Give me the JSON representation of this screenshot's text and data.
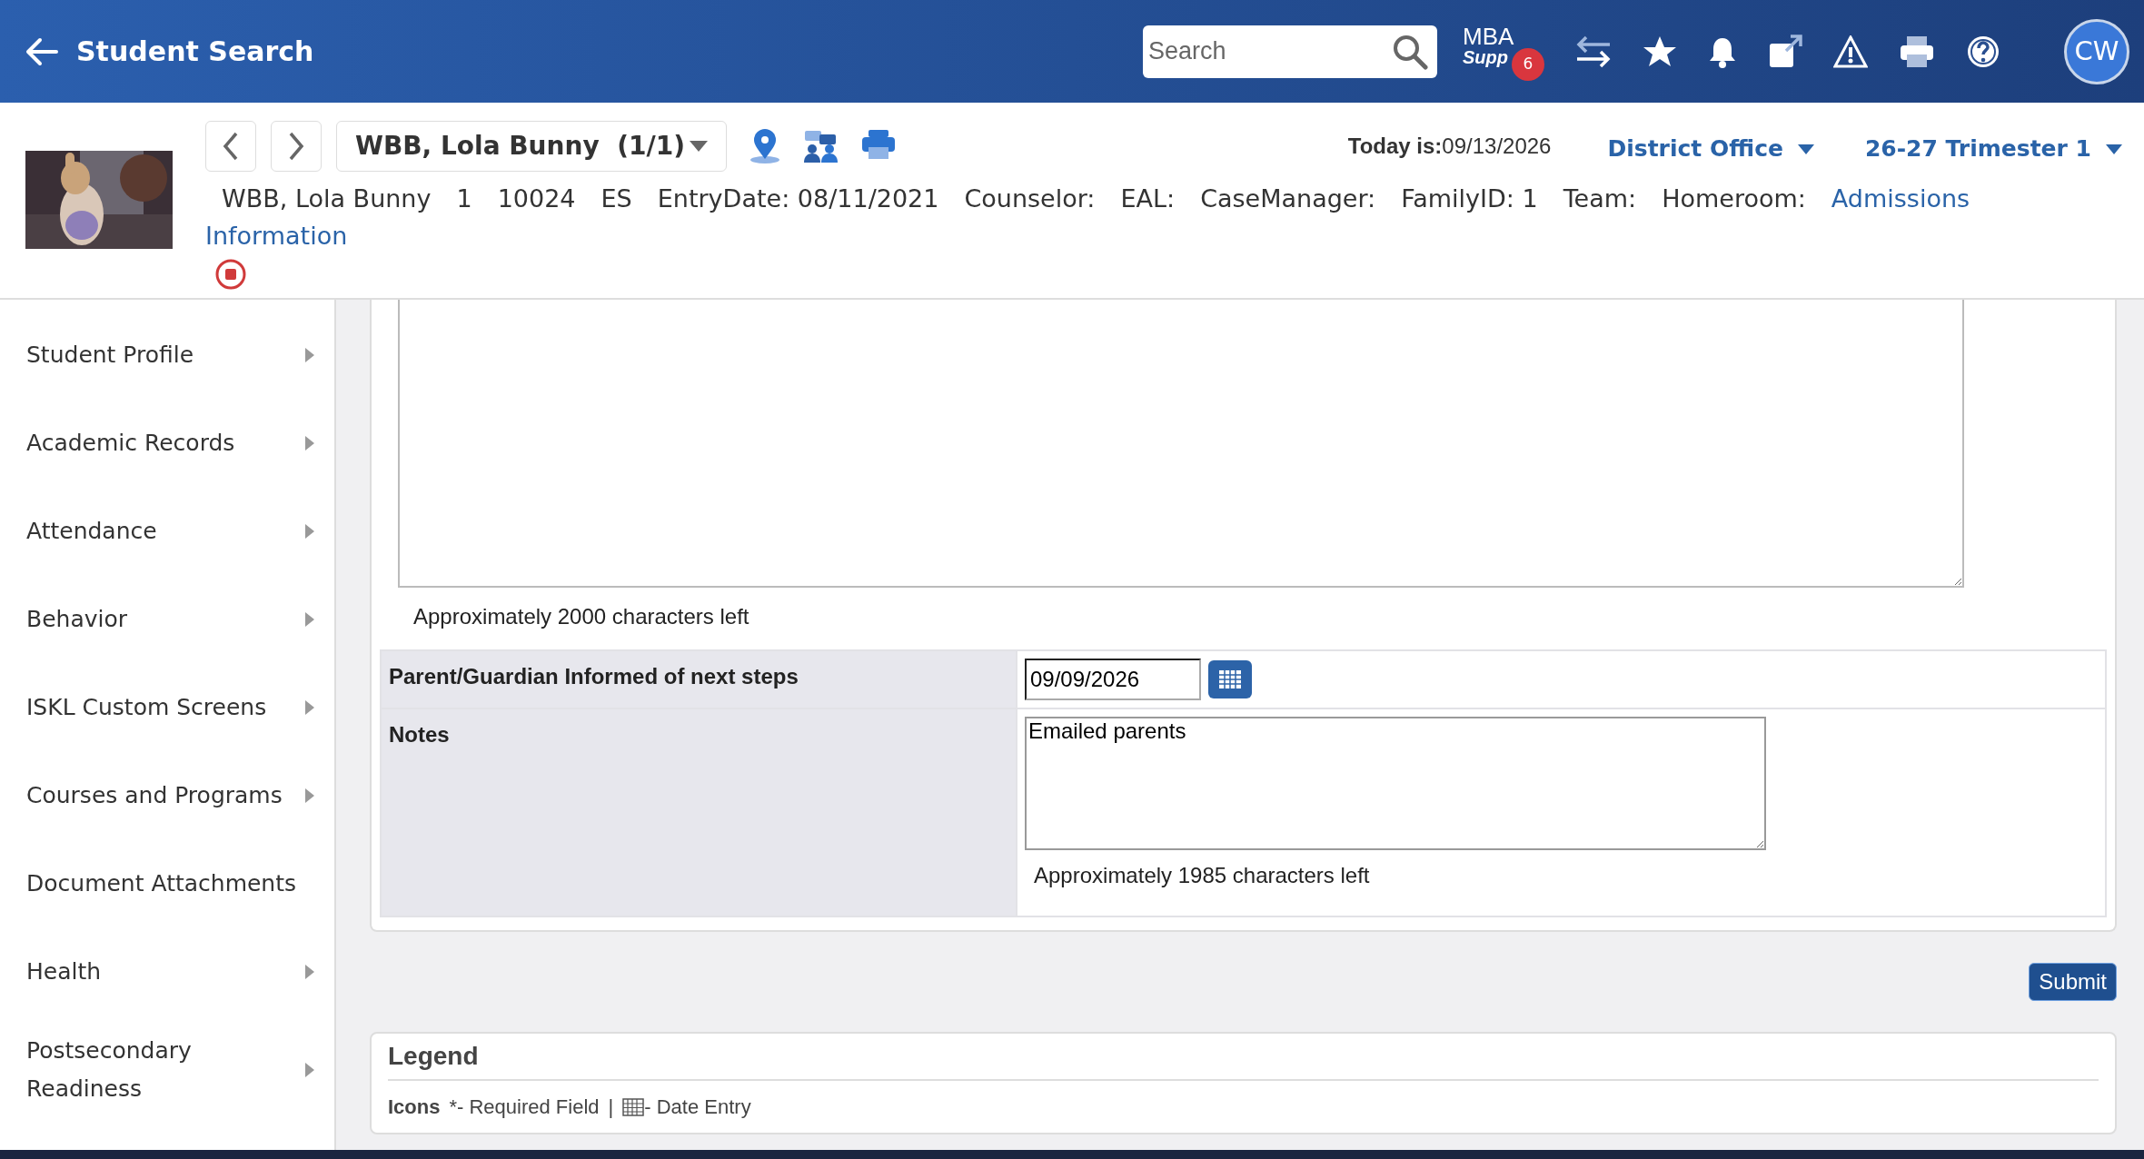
{
  "header": {
    "title": "Student Search",
    "search": {
      "placeholder": "Search"
    },
    "support_logo": {
      "line1": "MBA",
      "line2": "Supp",
      "badge": "6"
    },
    "avatar": "CW"
  },
  "student_bar": {
    "selector": "WBB, Lola Bunny  (1/1)",
    "today_label": "Today is:",
    "today": "09/13/2026",
    "school": "District Office",
    "term": "26-27 Trimester 1",
    "info": [
      "WBB, Lola Bunny",
      "1",
      "10024",
      "ES",
      "EntryDate: 08/11/2021",
      "Counselor:",
      "EAL:",
      "CaseManager:",
      "FamilyID: 1",
      "Team:",
      "Homeroom:"
    ],
    "links": [
      "Admissions",
      "Information"
    ]
  },
  "sidebar": {
    "items": [
      {
        "label": "Student Profile",
        "expandable": true
      },
      {
        "label": "Academic Records",
        "expandable": true
      },
      {
        "label": "Attendance",
        "expandable": true
      },
      {
        "label": "Behavior",
        "expandable": true
      },
      {
        "label": "ISKL Custom Screens",
        "expandable": true
      },
      {
        "label": "Courses and Programs",
        "expandable": true
      },
      {
        "label": "Document Attachments",
        "expandable": false
      },
      {
        "label": "Health",
        "expandable": true
      },
      {
        "label": "Postsecondary Readiness",
        "expandable": true
      }
    ]
  },
  "form": {
    "chars_left_top": "Approximately 2000 characters left",
    "rows": [
      {
        "kind": "date",
        "label": "Parent/Guardian Informed of next steps",
        "value": "09/09/2026"
      },
      {
        "kind": "notes",
        "label": "Notes",
        "value": "Emailed parents",
        "chars_left": "Approximately 1985 characters left"
      }
    ],
    "submit": "Submit"
  },
  "legend": {
    "title": "Legend",
    "icons_label": "Icons",
    "required": "*- Required Field",
    "separator": "|",
    "date_entry": "- Date Entry"
  }
}
